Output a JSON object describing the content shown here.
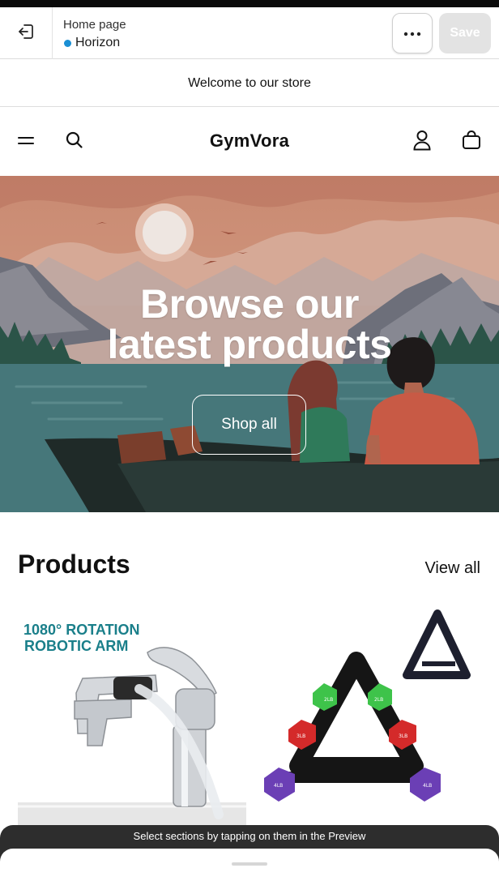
{
  "editor": {
    "page_label": "Home page",
    "theme_name": "Horizon",
    "more_label": "•••",
    "save_label": "Save"
  },
  "announcement": {
    "text": "Welcome to our store"
  },
  "store": {
    "logo": "GymVora"
  },
  "hero": {
    "title_line1": "Browse our",
    "title_line2": "latest products",
    "button_label": "Shop all"
  },
  "products": {
    "title": "Products",
    "view_all": "View all",
    "items": [
      {
        "image_text_line1": "1080° ROTATION",
        "image_text_line2": "ROBOTIC ARM"
      },
      {
        "weight_labels": [
          "2LB",
          "2LB",
          "3LB",
          "3LB",
          "4LB",
          "4LB"
        ]
      }
    ]
  },
  "preview_hint": {
    "text": "Select sections by tapping on them in the Preview"
  },
  "icons": {
    "exit": "exit-icon",
    "menu": "menu-icon",
    "search": "search-icon",
    "account": "account-icon",
    "cart": "bag-icon",
    "more": "more-icon"
  },
  "colors": {
    "theme_dot": "#1a8fd4",
    "save_disabled_bg": "#e3e3e3",
    "hint_bar": "#2d2d2d",
    "product_text": "#1a7f8a"
  }
}
